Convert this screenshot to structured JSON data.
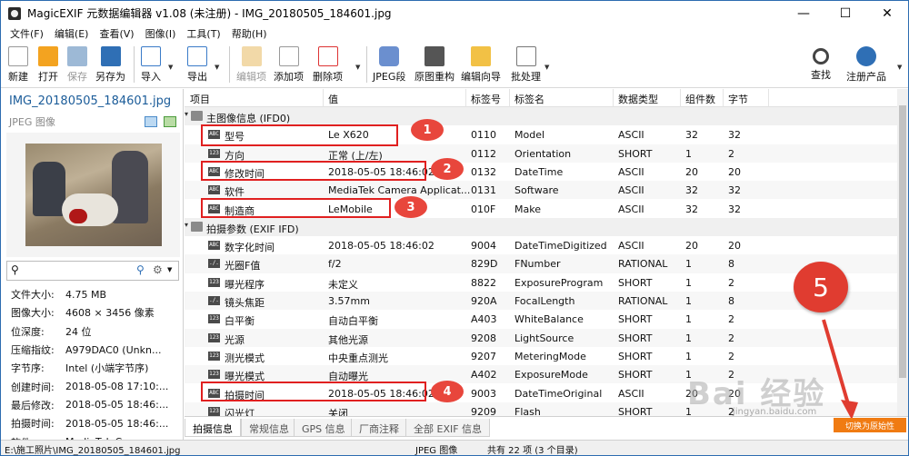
{
  "window": {
    "title": "MagicEXIF 元数据编辑器 v1.08 (未注册) - IMG_20180505_184601.jpg",
    "minimize": "—",
    "maximize": "☐",
    "close": "✕"
  },
  "menu": [
    "文件(F)",
    "编辑(E)",
    "查看(V)",
    "图像(I)",
    "工具(T)",
    "帮助(H)"
  ],
  "toolbar": {
    "new": "新建",
    "open": "打开",
    "save": "保存",
    "saveas": "另存为",
    "import": "导入",
    "export": "导出",
    "edit_item": "编辑项",
    "add_item": "添加项",
    "delete_item": "删除项",
    "jpeg_segment": "JPEG段",
    "rebuild": "原图重构",
    "wizard": "编辑向导",
    "batch": "批处理",
    "find": "查找",
    "register": "注册产品"
  },
  "left": {
    "filename": "IMG_20180505_184601.jpg",
    "filetype": "JPEG 图像",
    "search_placeholder": "",
    "props": [
      {
        "k": "文件大小:",
        "v": "4.75 MB"
      },
      {
        "k": "图像大小:",
        "v": "4608 × 3456 像素"
      },
      {
        "k": "位深度:",
        "v": "24 位"
      },
      {
        "k": "压缩指纹:",
        "v": "A979DAC0 (Unkn..."
      },
      {
        "k": "字节序:",
        "v": "Intel (小端字节序)"
      },
      {
        "k": "创建时间:",
        "v": "2018-05-08 17:10:..."
      },
      {
        "k": "最后修改:",
        "v": "2018-05-05 18:46:..."
      },
      {
        "k": "拍摄时间:",
        "v": "2018-05-05 18:46:..."
      },
      {
        "k": "软件:",
        "v": "MediaTek Camer..."
      }
    ]
  },
  "grid": {
    "headers": [
      "项目",
      "值",
      "标签号",
      "标签名",
      "数据类型",
      "组件数",
      "字节"
    ],
    "rows": [
      {
        "group": true,
        "name": "主图像信息 (IFD0)"
      },
      {
        "icon": "ABC",
        "name": "型号",
        "value": "Le X620",
        "tag": "0110",
        "tagname": "Model",
        "type": "ASCII",
        "count": "32",
        "bytes": "32"
      },
      {
        "icon": "123",
        "name": "方向",
        "value": "正常 (上/左)",
        "tag": "0112",
        "tagname": "Orientation",
        "type": "SHORT",
        "count": "1",
        "bytes": "2"
      },
      {
        "icon": "ABC",
        "name": "修改时间",
        "value": "2018-05-05 18:46:02",
        "tag": "0132",
        "tagname": "DateTime",
        "type": "ASCII",
        "count": "20",
        "bytes": "20"
      },
      {
        "icon": "ABC",
        "name": "软件",
        "value": "MediaTek Camera Applicat...",
        "tag": "0131",
        "tagname": "Software",
        "type": "ASCII",
        "count": "32",
        "bytes": "32"
      },
      {
        "icon": "ABC",
        "name": "制造商",
        "value": "LeMobile",
        "tag": "010F",
        "tagname": "Make",
        "type": "ASCII",
        "count": "32",
        "bytes": "32"
      },
      {
        "group": true,
        "name": "拍摄参数 (EXIF IFD)"
      },
      {
        "icon": "ABC",
        "name": "数字化时间",
        "value": "2018-05-05 18:46:02",
        "tag": "9004",
        "tagname": "DateTimeDigitized",
        "type": "ASCII",
        "count": "20",
        "bytes": "20"
      },
      {
        "icon": "./.",
        "name": "光圈F值",
        "value": "f/2",
        "tag": "829D",
        "tagname": "FNumber",
        "type": "RATIONAL",
        "count": "1",
        "bytes": "8"
      },
      {
        "icon": "123",
        "name": "曝光程序",
        "value": "未定义",
        "tag": "8822",
        "tagname": "ExposureProgram",
        "type": "SHORT",
        "count": "1",
        "bytes": "2"
      },
      {
        "icon": "./.",
        "name": "镜头焦距",
        "value": "3.57mm",
        "tag": "920A",
        "tagname": "FocalLength",
        "type": "RATIONAL",
        "count": "1",
        "bytes": "8"
      },
      {
        "icon": "123",
        "name": "白平衡",
        "value": "自动白平衡",
        "tag": "A403",
        "tagname": "WhiteBalance",
        "type": "SHORT",
        "count": "1",
        "bytes": "2"
      },
      {
        "icon": "123",
        "name": "光源",
        "value": "其他光源",
        "tag": "9208",
        "tagname": "LightSource",
        "type": "SHORT",
        "count": "1",
        "bytes": "2"
      },
      {
        "icon": "123",
        "name": "测光模式",
        "value": "中央重点测光",
        "tag": "9207",
        "tagname": "MeteringMode",
        "type": "SHORT",
        "count": "1",
        "bytes": "2"
      },
      {
        "icon": "123",
        "name": "曝光模式",
        "value": "自动曝光",
        "tag": "A402",
        "tagname": "ExposureMode",
        "type": "SHORT",
        "count": "1",
        "bytes": "2"
      },
      {
        "icon": "ABC",
        "name": "拍摄时间",
        "value": "2018-05-05 18:46:02",
        "tag": "9003",
        "tagname": "DateTimeOriginal",
        "type": "ASCII",
        "count": "20",
        "bytes": "20"
      },
      {
        "icon": "123",
        "name": "闪光灯",
        "value": "关闭",
        "tag": "9209",
        "tagname": "Flash",
        "type": "SHORT",
        "count": "1",
        "bytes": "2"
      }
    ]
  },
  "tabs": [
    "拍摄信息",
    "常规信息",
    "GPS 信息",
    "厂商注释",
    "全部 EXIF 信息"
  ],
  "status": {
    "path": "E:\\施工照片\\IMG_20180505_184601.jpg",
    "type": "JPEG 图像",
    "count": "共有 22 项 (3 个目录)"
  },
  "annotations": [
    "1",
    "2",
    "3",
    "4",
    "5"
  ],
  "watermark": {
    "brand": "Bai 经验",
    "url": "jingyan.baidu.com",
    "badge": "切换为原始性"
  }
}
